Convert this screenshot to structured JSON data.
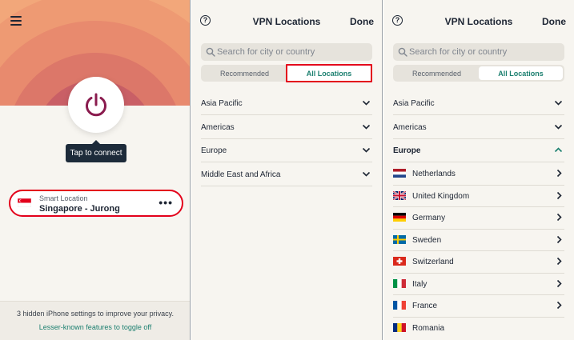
{
  "colors": {
    "accent_teal": "#1b7f6f",
    "highlight_red": "#e3001b",
    "power_purple": "#8a1b4e",
    "dark_navy": "#1d2b3a"
  },
  "home": {
    "menu_icon": "hamburger-menu-icon",
    "power_icon": "power-icon",
    "tooltip": "Tap to connect",
    "location": {
      "small_label": "Smart Location",
      "name": "Singapore - Jurong",
      "flag": "singapore-flag-icon",
      "more_icon": "more-options-icon"
    },
    "footer": {
      "line1": "3 hidden iPhone settings to improve your privacy.",
      "line2": "Lesser-known features to toggle off"
    }
  },
  "locations_collapsed": {
    "title": "VPN Locations",
    "done": "Done",
    "search_placeholder": "Search for city or country",
    "tabs": {
      "recommended": "Recommended",
      "all": "All Locations",
      "selected": "all"
    },
    "regions": [
      "Asia Pacific",
      "Americas",
      "Europe",
      "Middle East and Africa"
    ]
  },
  "locations_expanded": {
    "title": "VPN Locations",
    "done": "Done",
    "search_placeholder": "Search for city or country",
    "tabs": {
      "recommended": "Recommended",
      "all": "All Locations",
      "selected": "all"
    },
    "regions": [
      "Asia Pacific",
      "Americas",
      "Europe"
    ],
    "expanded_region": "Europe",
    "countries": [
      "Netherlands",
      "United Kingdom",
      "Germany",
      "Sweden",
      "Switzerland",
      "Italy",
      "France",
      "Romania"
    ]
  }
}
